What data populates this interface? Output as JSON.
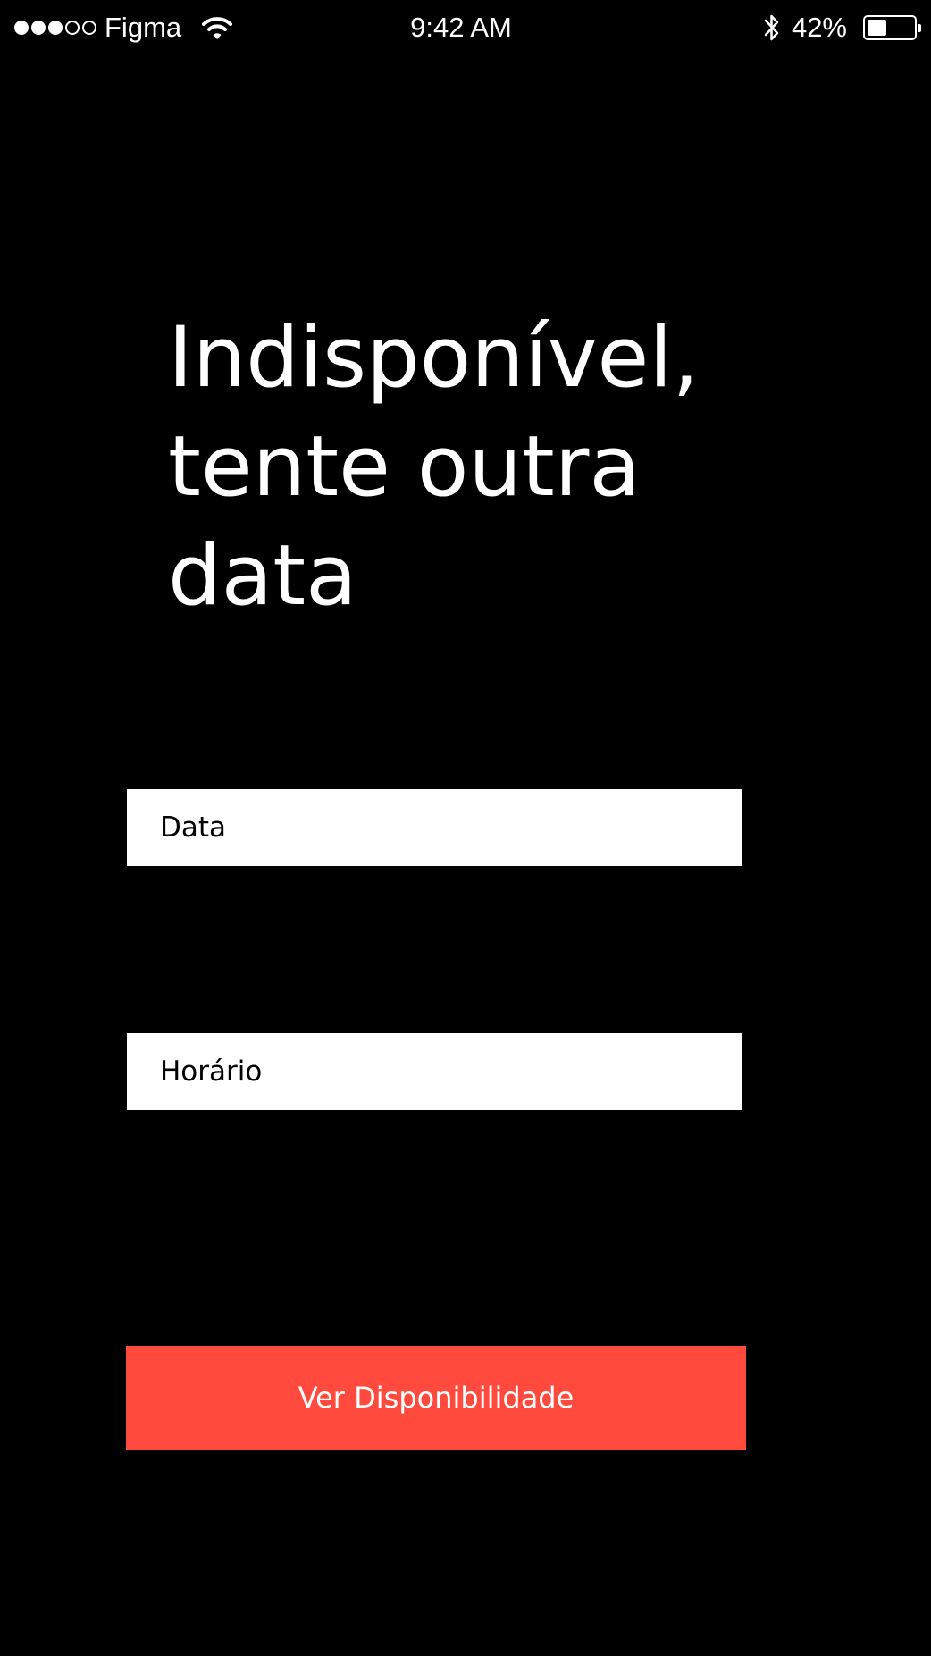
{
  "status_bar": {
    "carrier": "Figma",
    "time": "9:42 AM",
    "battery_percent_label": "42%",
    "battery_level": 0.42,
    "signal_strength": 3,
    "signal_total": 5,
    "icons": [
      "signal-dots-icon",
      "wifi-icon",
      "bluetooth-icon",
      "battery-icon"
    ]
  },
  "headline": {
    "lines": [
      "Indisponível,",
      "tente outra",
      "data"
    ]
  },
  "form": {
    "date_placeholder": "Data",
    "time_placeholder": "Horário",
    "submit_label": "Ver Disponibilidade"
  },
  "colors": {
    "background": "#000000",
    "text": "#ffffff",
    "field_background": "#ffffff",
    "field_text": "#000000",
    "accent": "#ff4a3d"
  }
}
